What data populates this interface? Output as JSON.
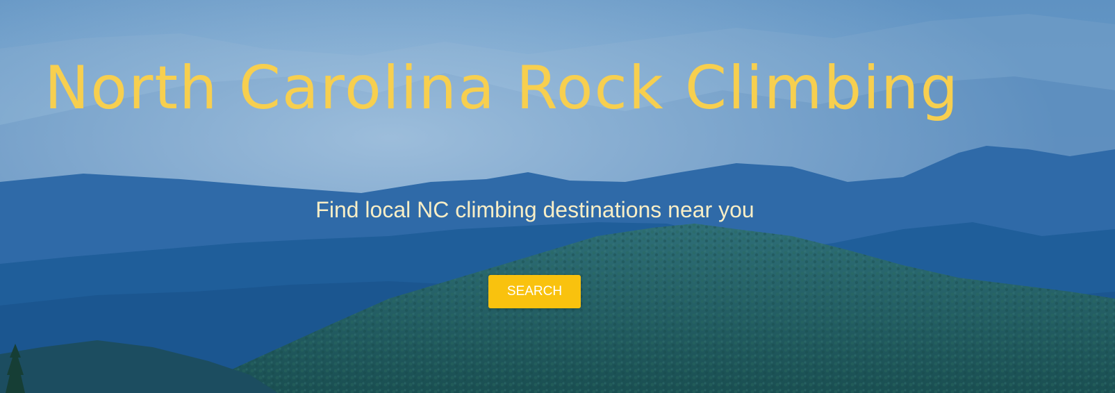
{
  "hero": {
    "title": "North Carolina Rock Climbing",
    "subtitle": "Find local NC climbing destinations near you",
    "search_label": "SEARCH"
  },
  "colors": {
    "title": "#f7cf4f",
    "subtitle": "#f8eec6",
    "button": "#f9c20e",
    "button_text": "#ffffff",
    "sky": "#5e8fc0",
    "mountains": "#1f5f9a",
    "forest": "#1f5c60"
  },
  "background": {
    "description_icon": "mountain-landscape"
  }
}
